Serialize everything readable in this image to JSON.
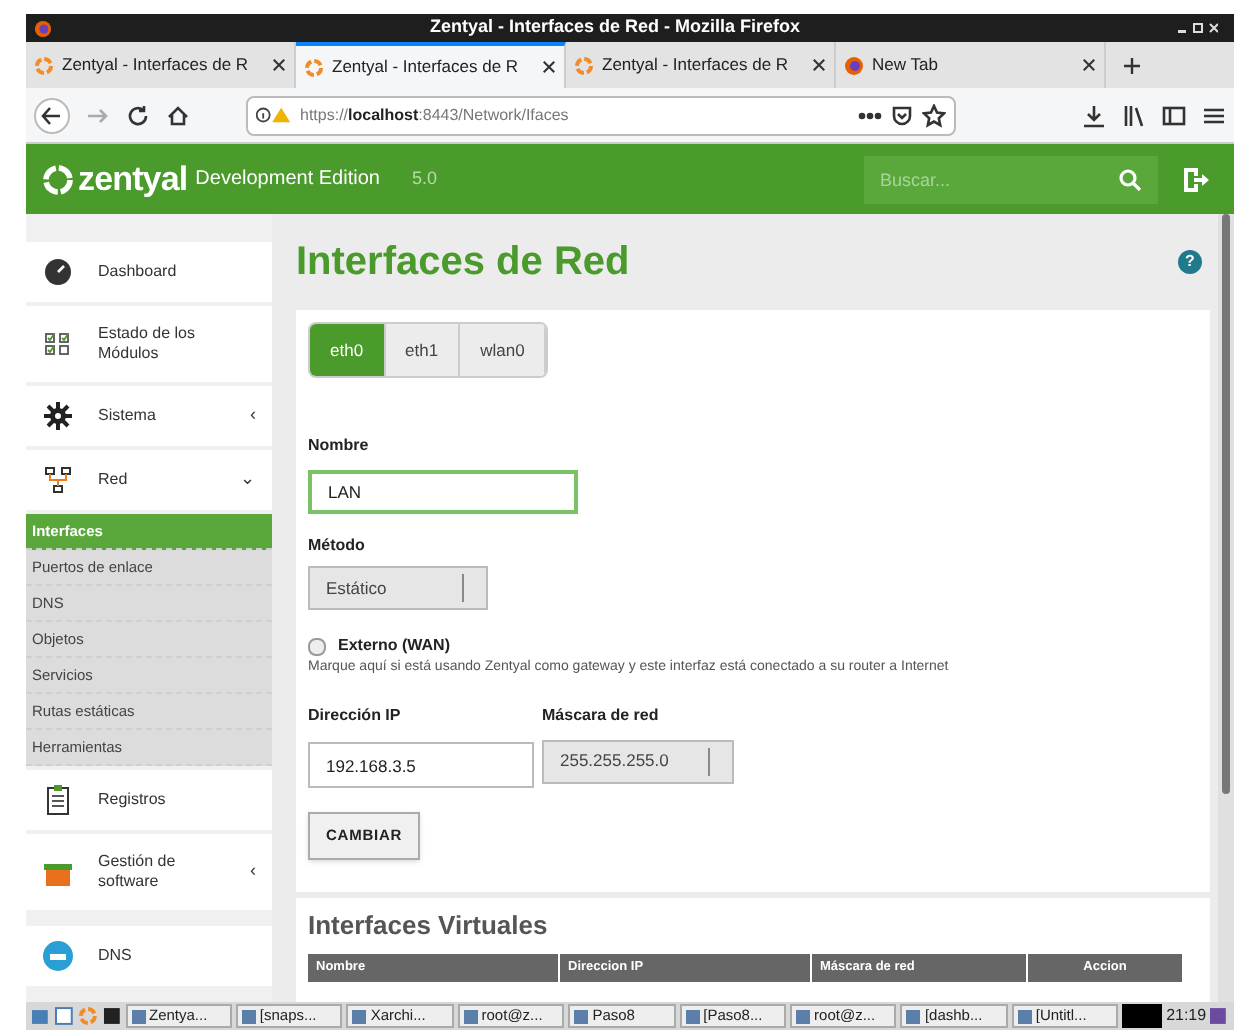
{
  "window": {
    "title": "Zentyal - Interfaces de Red - Mozilla Firefox"
  },
  "browser_tabs": [
    {
      "label": "Zentyal - Interfaces de R",
      "kind": "zentyal",
      "selected": false
    },
    {
      "label": "Zentyal - Interfaces de R",
      "kind": "zentyal",
      "selected": true
    },
    {
      "label": "Zentyal - Interfaces de R",
      "kind": "zentyal",
      "selected": false
    },
    {
      "label": "New Tab",
      "kind": "firefox",
      "selected": false
    }
  ],
  "address_bar": {
    "url_prefix": "https://",
    "url_host": "localhost",
    "url_rest": ":8443/Network/Ifaces"
  },
  "header": {
    "logo": "zentyal",
    "edition": "Development Edition",
    "version": "5.0",
    "search": {
      "placeholder": "Buscar..."
    }
  },
  "sidebar": {
    "items": [
      {
        "label": "Dashboard",
        "kind": "dashboard"
      },
      {
        "label": "Estado de los Módulos",
        "kind": "modules"
      },
      {
        "label": "Sistema",
        "kind": "gear",
        "chevron": "‹"
      },
      {
        "label": "Red",
        "kind": "network",
        "chevron": "⌄",
        "children": [
          {
            "label": "Interfaces",
            "selected": true
          },
          {
            "label": "Puertos de enlace",
            "selected": false
          },
          {
            "label": "DNS",
            "selected": false
          },
          {
            "label": "Objetos",
            "selected": false
          },
          {
            "label": "Servicios",
            "selected": false
          },
          {
            "label": "Rutas estáticas",
            "selected": false
          },
          {
            "label": "Herramientas",
            "selected": false
          }
        ]
      },
      {
        "label": "Registros",
        "kind": "clipboard"
      },
      {
        "label": "Gestión de software",
        "kind": "package",
        "chevron": "‹"
      },
      {
        "label": "DNS",
        "kind": "dns"
      }
    ]
  },
  "page": {
    "title": "Interfaces de Red",
    "help": "?",
    "iface_tabs": [
      {
        "label": "eth0",
        "selected": true
      },
      {
        "label": "eth1",
        "selected": false
      },
      {
        "label": "wlan0",
        "selected": false
      }
    ],
    "form": {
      "name_label": "Nombre",
      "name_value": "LAN",
      "method_label": "Método",
      "method_value": "Estático",
      "external": {
        "label": "Externo (WAN)",
        "checked": false,
        "help": "Marque aquí si está usando Zentyal como gateway y este interfaz está conectado a su router a Internet"
      },
      "ip_label": "Dirección IP",
      "ip_value": "192.168.3.5",
      "mask_label": "Máscara de red",
      "mask_value": "255.255.255.0",
      "submit": "CAMBIAR"
    },
    "virtual": {
      "title": "Interfaces Virtuales",
      "columns": [
        "Nombre",
        "Direccion IP",
        "Máscara de red",
        "Accion"
      ]
    }
  },
  "taskbar": {
    "items": [
      "Zentya...",
      "[snaps...",
      "Xarchi...",
      "root@z...",
      "Paso8",
      "[Paso8...",
      "root@z...",
      "[dashb...",
      "[Untitl..."
    ],
    "clock": "21:19"
  }
}
